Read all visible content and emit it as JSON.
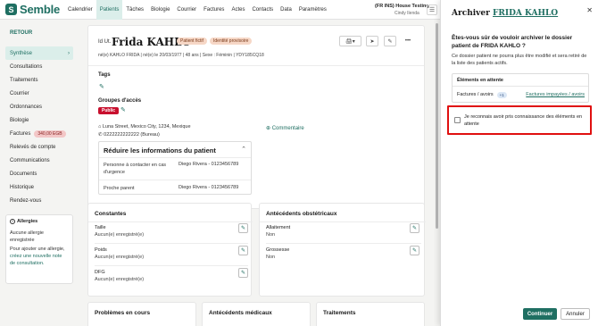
{
  "brand": {
    "logo_letter": "S",
    "name": "Semble",
    "color": "#1f6f62"
  },
  "topnav": {
    "items": [
      "Calendrier",
      "Patients",
      "Tâches",
      "Biologie",
      "Courrier",
      "Factures",
      "Actes",
      "Contacts",
      "Data",
      "Paramètres"
    ],
    "active": "Patients",
    "org_name": "(FR INS) House Testing",
    "user_name": "Cindy Ilenda",
    "menu_icon": "hamburger-icon"
  },
  "sidebar": {
    "back_label": "RETOUR",
    "items": [
      {
        "label": "Synthèse",
        "active": true,
        "chevron": "›"
      },
      {
        "label": "Consultations"
      },
      {
        "label": "Traitements"
      },
      {
        "label": "Courrier"
      },
      {
        "label": "Ordonnances"
      },
      {
        "label": "Biologie"
      },
      {
        "label": "Factures",
        "badge": "340,00 EGB"
      },
      {
        "label": "Relevés de compte"
      },
      {
        "label": "Communications"
      },
      {
        "label": "Documents"
      },
      {
        "label": "Historique"
      },
      {
        "label": "Rendez-vous"
      }
    ],
    "allergies": {
      "title": "Allergies",
      "empty": "Aucune allergie enregistrée",
      "hint_prefix": "Pour ajouter une allergie,",
      "hint_link": "créez une nouvelle note de consultation."
    }
  },
  "patient": {
    "id_prefix": "Id Ut.",
    "name": "Frida KAHLO",
    "tags": [
      "Patient fictif",
      "Identité provisoire"
    ],
    "meta": "né(e) KAHLO FRIDA  |  né(e) le 20/03/1977  |  48 ans  |  Sexe : Féminin  |  YDY185CQ18",
    "actions": {
      "print": "🖨▾",
      "send": "➤",
      "edit": "✎",
      "more": "•••"
    },
    "tags_label": "Tags",
    "groups_label": "Groupes d'accès",
    "group_pill": "Public",
    "address": "Luna Street, Mexico City, 1234, Mexique",
    "phone": "0222222222222 (Bureau)",
    "comment_label": "Commentaire",
    "reduce": {
      "title": "Réduire les informations du patient",
      "rows": [
        {
          "label": "Personne à contacter en cas d'urgence",
          "value": "Diego Rivera - 0123456789"
        },
        {
          "label": "Proche parent",
          "value": "Diego Rivera - 0123456789"
        }
      ]
    }
  },
  "constantes": {
    "title": "Constantes",
    "fields": [
      {
        "label": "Taille",
        "value": "Aucun(e) enregistré(e)"
      },
      {
        "label": "Poids",
        "value": "Aucun(e) enregistré(e)"
      },
      {
        "label": "DFG",
        "value": "Aucun(e) enregistré(e)"
      }
    ]
  },
  "obstetriques": {
    "title": "Antécédents obstétricaux",
    "fields": [
      {
        "label": "Allaitement",
        "value": "Non"
      },
      {
        "label": "Grossesse",
        "value": "Non"
      }
    ]
  },
  "bottom_cards": [
    "Problèmes en cours",
    "Antécédents médicaux",
    "Traitements"
  ],
  "dialog": {
    "title_prefix": "Archiver",
    "title_name": "FRIDA KAHLO",
    "close": "✕",
    "question": "Êtes-vous sûr de vouloir archiver le dossier patient de FRIDA KAHLO ?",
    "description": "Ce dossier patient ne pourra plus être modifié et sera retiré de la liste des patients actifs.",
    "pending_title": "Éléments en attente",
    "pending_item": "Factures / avoirs",
    "pending_count": "+1",
    "pending_link": "Factures impayées / avoirs",
    "confirm_text": "Je reconnais avoir pris connaissance des éléments en attente",
    "confirm_checked": false,
    "continue_label": "Continuer",
    "cancel_label": "Annuler",
    "highlight_color": "#e01010"
  }
}
